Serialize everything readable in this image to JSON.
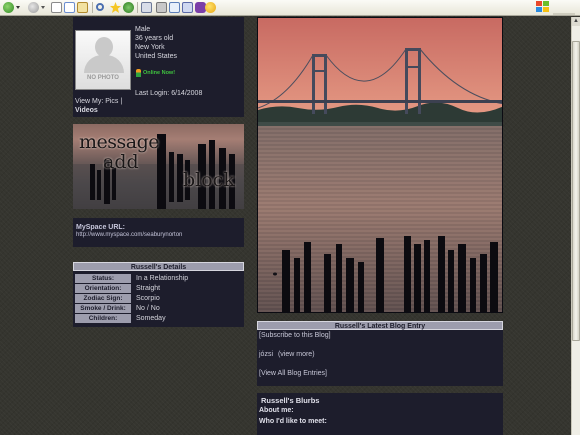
{
  "profile": {
    "no_photo_label": "NO PHOTO",
    "gender": "Male",
    "age": "36 years old",
    "city": "New York",
    "country": "United States",
    "online_status": "Online Now!",
    "last_login": "Last Login: 6/14/2008",
    "view_pics": "View My: Pics |",
    "videos": "Videos"
  },
  "banner": {
    "words": [
      "message",
      "add",
      "block"
    ]
  },
  "myspace_url": {
    "label": "MySpace URL:",
    "value": "http://www.myspace.com/seaburynorton"
  },
  "details": {
    "header": "Russell's Details",
    "rows": [
      {
        "key": "Status:",
        "value": "In a Relationship"
      },
      {
        "key": "Orientation:",
        "value": "Straight"
      },
      {
        "key": "Zodiac Sign:",
        "value": "Scorpio"
      },
      {
        "key": "Smoke / Drink:",
        "value": "No / No"
      },
      {
        "key": "Children:",
        "value": "Someday"
      }
    ]
  },
  "blog": {
    "header": "Russell's Latest Blog Entry",
    "subscribe": "[Subscribe to this Blog]",
    "entry_title": "józsi",
    "view_more": "(view more)",
    "view_all": "[View All Blog Entries]"
  },
  "blurbs": {
    "header": "Russell's Blurbs",
    "about": "About me:",
    "meet": "Who I'd like to meet:"
  },
  "colors": {
    "box_bg": "#1d1d2c",
    "header_bg": "#9d9dad",
    "page_bg": "#35352f",
    "sky": "#d9857a"
  },
  "icons": {
    "toolbar": [
      "back-icon",
      "forward-icon",
      "stop-icon",
      "refresh-icon",
      "home-icon",
      "search-icon",
      "favorites-icon",
      "history-icon",
      "mail-icon",
      "print-icon",
      "messenger-icon",
      "emoticon-icon"
    ]
  }
}
